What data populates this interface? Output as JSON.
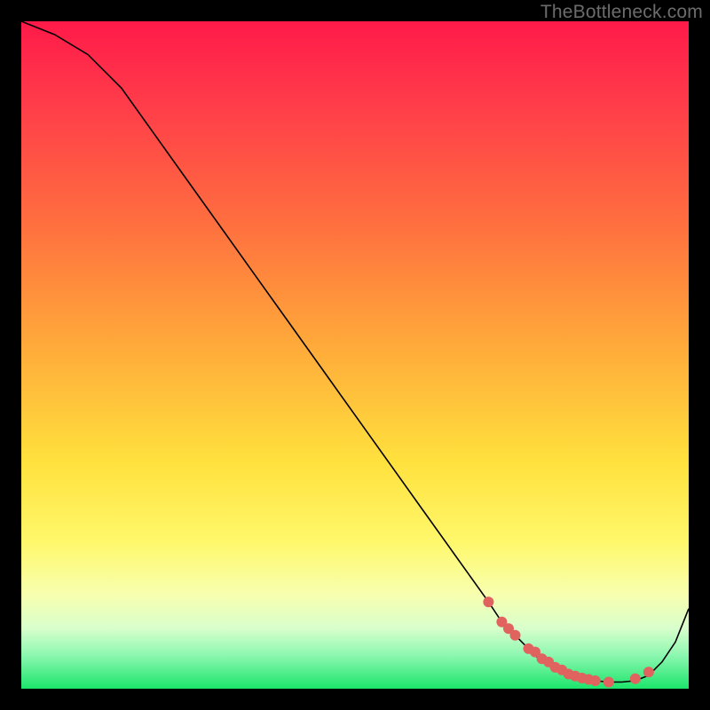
{
  "watermark": "TheBottleneck.com",
  "colors": {
    "gradient_top": "#ff1a49",
    "gradient_mid": "#ffe13d",
    "gradient_bottom": "#1be56b",
    "curve": "#000000",
    "dots": "#e0635f",
    "frame_bg": "#000000"
  },
  "chart_data": {
    "type": "line",
    "title": "",
    "xlabel": "",
    "ylabel": "",
    "xlim": [
      0,
      100
    ],
    "ylim": [
      0,
      100
    ],
    "grid": false,
    "legend": false,
    "x": [
      0,
      5,
      10,
      15,
      20,
      25,
      30,
      35,
      40,
      45,
      50,
      55,
      60,
      65,
      70,
      72,
      74,
      76,
      78,
      80,
      82,
      84,
      86,
      88,
      90,
      92,
      94,
      96,
      98,
      100
    ],
    "y": [
      100,
      98,
      95,
      90,
      83,
      76,
      69,
      62,
      55,
      48,
      41,
      34,
      27,
      20,
      13,
      10,
      8,
      6,
      4,
      3,
      2,
      1.5,
      1.2,
      1,
      1,
      1.2,
      2,
      4,
      7,
      12
    ],
    "marker_x": [
      70,
      72,
      73,
      74,
      76,
      77,
      78,
      79,
      80,
      81,
      82,
      83,
      84,
      85,
      86,
      88,
      92,
      94
    ],
    "marker_y": [
      13,
      10,
      9,
      8,
      6,
      5.5,
      4.5,
      4,
      3.2,
      2.8,
      2.2,
      1.9,
      1.6,
      1.4,
      1.2,
      1,
      1.5,
      2.5
    ]
  }
}
